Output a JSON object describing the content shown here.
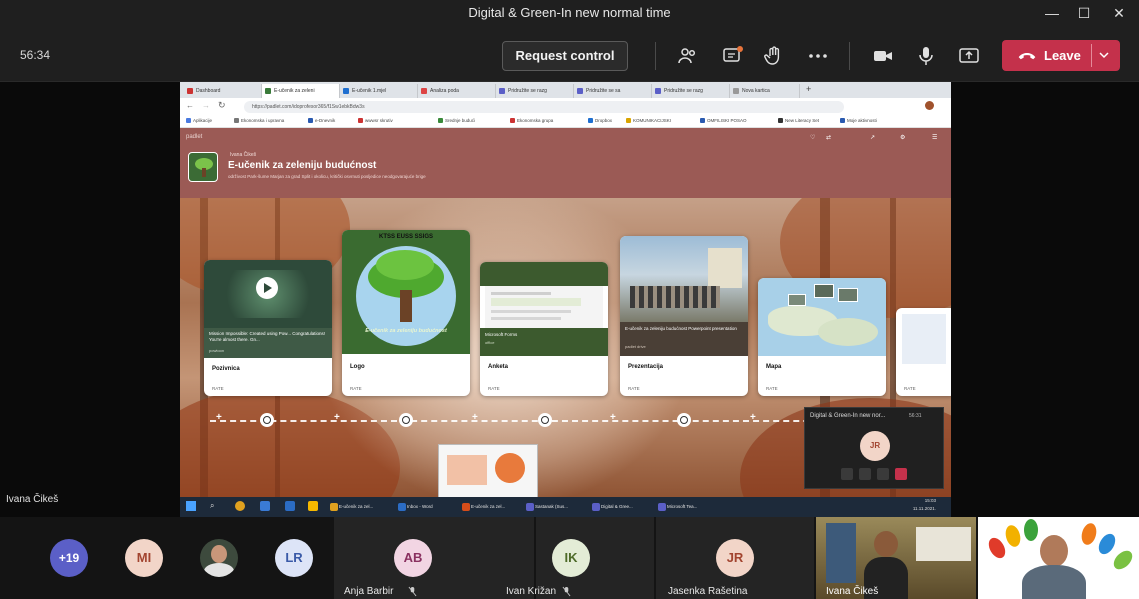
{
  "window": {
    "title": "Digital & Green-In new normal time",
    "controls": [
      "minimize-icon",
      "maximize-icon",
      "close-icon"
    ]
  },
  "toolbar": {
    "timer": "56:34",
    "request_control_label": "Request control",
    "leave_label": "Leave",
    "icons": [
      "participants-icon",
      "chat-icon",
      "raise-hand-icon",
      "more-icon",
      "camera-icon",
      "microphone-icon",
      "share-icon"
    ],
    "leave_color": "#c4314b"
  },
  "presenter": {
    "name": "Ivana Čikeš"
  },
  "browser": {
    "tabs": [
      "Dashboard",
      "E-učenik za zeleni",
      "E-učenik 1.mjel",
      "Analiza poda",
      "Pridružite se razg",
      "Pridružite se sa",
      "Pridružite se razg",
      "Nova kartica"
    ],
    "url": "https://padlet.com/idoprofesor365/f1Sw1ebkBdw3s",
    "bookmarks": [
      "Aplikacije",
      "Ekonomska i upravna",
      "e-Dnevnik",
      "wwwsr skrutiv",
      "Srednje budući",
      "Ekonomska grupa",
      "Dropbox",
      "KOMUNIKACIJSKI",
      "OMFILISKI POSAO",
      "New Literacy Set",
      "Moje aktivnosti"
    ]
  },
  "padlet": {
    "brand": "padlet",
    "author": "Ivana Čikeš",
    "title": "E-učenik za zeleniju budućnost",
    "subtitle": "održivost Park-šume Marjan za grad Split i okolicu, kritički osvrnuti posljedice neodgovarajuće brige",
    "header_color": "#9b5a55",
    "cards": [
      {
        "label": "Pozivnica",
        "caption": "Mission Impossible: Created using Pow... Congratulations! You're almost there. Gn...",
        "source": "powtoon"
      },
      {
        "label": "Logo",
        "logo_text_top": "KTSS  EUSS  SSIGS",
        "logo_text_bottom": "E-učenik za zeleniju budućnost"
      },
      {
        "label": "Anketa",
        "caption": "Microsoft Forms",
        "source": "office"
      },
      {
        "label": "Prezentacija",
        "caption": "E-učenik za zeleniju budućnost Powerpoint presentation",
        "source": "padlet drive"
      },
      {
        "label": "Mapa"
      }
    ],
    "rate_label": "RATE"
  },
  "taskbar": {
    "apps": [
      "E-učenik za zel...",
      "Inbox - Word",
      "E-učenik za zel...",
      "Sastanak (Sus...",
      "Digital & Gree...",
      "Microsoft Tea..."
    ],
    "time": "15:03",
    "date": "11.11.2021."
  },
  "mini_window": {
    "title": "Digital & Green-In new nor...",
    "time": "56:31",
    "initials": "JR"
  },
  "gallery": {
    "overflow_count": "+19",
    "participants": [
      {
        "initials": "MI",
        "bg": "#f2d5c8",
        "fg": "#a2442f"
      },
      {
        "initials": "LR",
        "bg": "#dde4f7",
        "fg": "#3a5aa8"
      },
      {
        "initials": "AB",
        "name": "Anja Barbir",
        "bg": "#f2d5e3",
        "fg": "#8a3160"
      },
      {
        "initials": "IK",
        "name": "Ivan Križan",
        "bg": "#e3ecd6",
        "fg": "#4d6a28"
      },
      {
        "initials": "JR",
        "name": "Jasenka Rašetina",
        "bg": "#f2d5c8",
        "fg": "#a2442f"
      },
      {
        "name": "Ivana Čikeš"
      }
    ]
  }
}
